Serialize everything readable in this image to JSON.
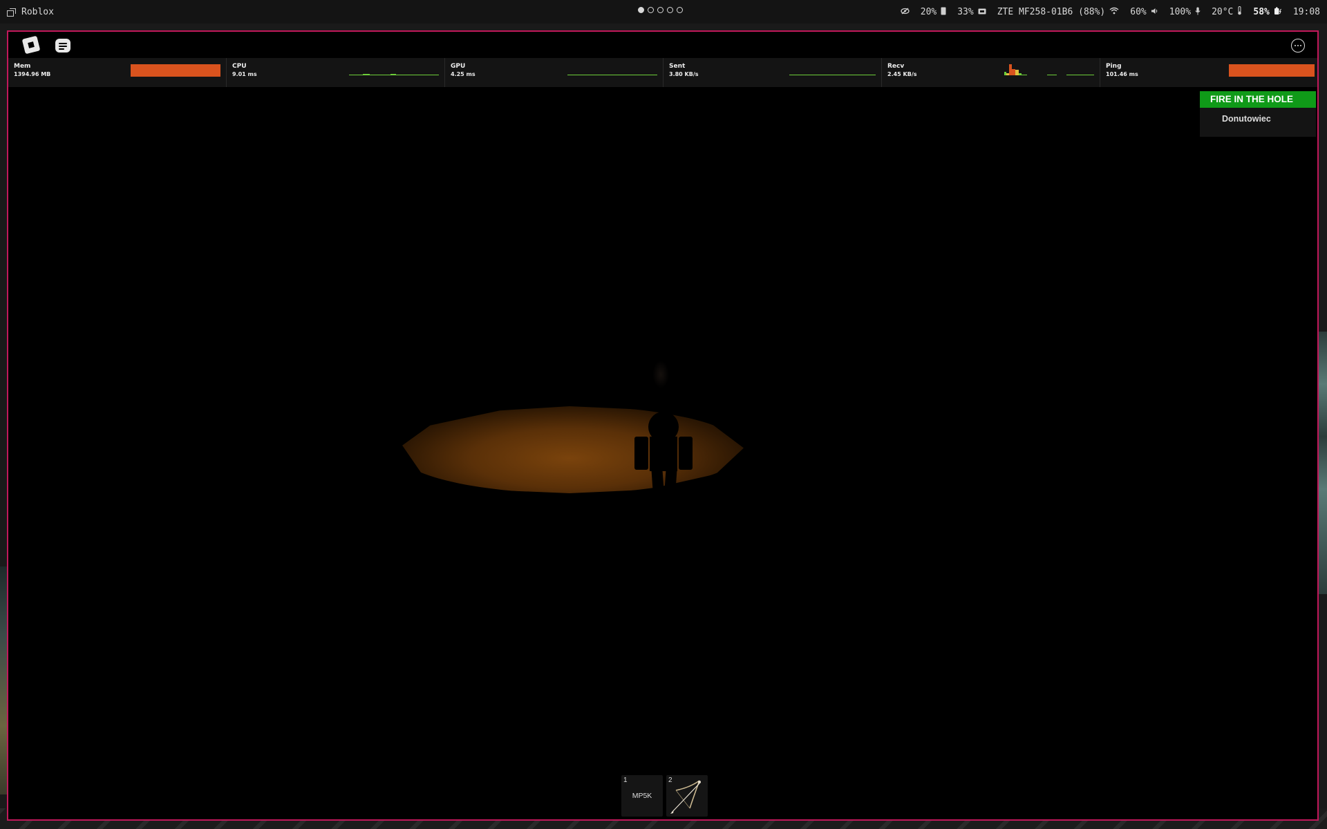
{
  "topbar": {
    "app_title": "Roblox",
    "workspaces": [
      {
        "id": 1,
        "active": true
      },
      {
        "id": 2,
        "active": false
      },
      {
        "id": 3,
        "active": false
      },
      {
        "id": 4,
        "active": false
      },
      {
        "id": 5,
        "active": false
      }
    ],
    "status": {
      "privacy_icon": "eye-slash-icon",
      "disk": "20%",
      "disk_icon": "drive-icon",
      "memory": "33%",
      "memory_icon": "memory-icon",
      "network": "ZTE MF258-01B6 (88%)",
      "wifi_icon": "wifi-icon",
      "brightness": "60%",
      "volume_icon": "speaker-icon",
      "volume": "100%",
      "mic_icon": "microphone-icon",
      "temperature": "20°C",
      "temp_icon": "thermometer-icon",
      "battery": "58%",
      "battery_icon": "battery-charging-icon",
      "time": "19:08"
    }
  },
  "roblox": {
    "perf_stats": [
      {
        "label": "Mem",
        "value": "1394.96 MB"
      },
      {
        "label": "CPU",
        "value": "9.01 ms"
      },
      {
        "label": "GPU",
        "value": "4.25 ms"
      },
      {
        "label": "Sent",
        "value": "3.80 KB/s"
      },
      {
        "label": "Recv",
        "value": "2.45 KB/s"
      },
      {
        "label": "Ping",
        "value": "101.46 ms"
      }
    ],
    "leaderboard": {
      "title": "FIRE IN THE HOLE",
      "players": [
        "Donutowiec"
      ]
    },
    "hotbar": [
      {
        "slot": "1",
        "name": "MP5K"
      },
      {
        "slot": "2",
        "name": "",
        "icon": "bow-icon"
      }
    ]
  },
  "colors": {
    "accent_border": "#c2185b",
    "leaderboard_green": "#0f9a18",
    "perf_bar_orange": "#d9531e",
    "graph_green": "#6ecf3a"
  }
}
